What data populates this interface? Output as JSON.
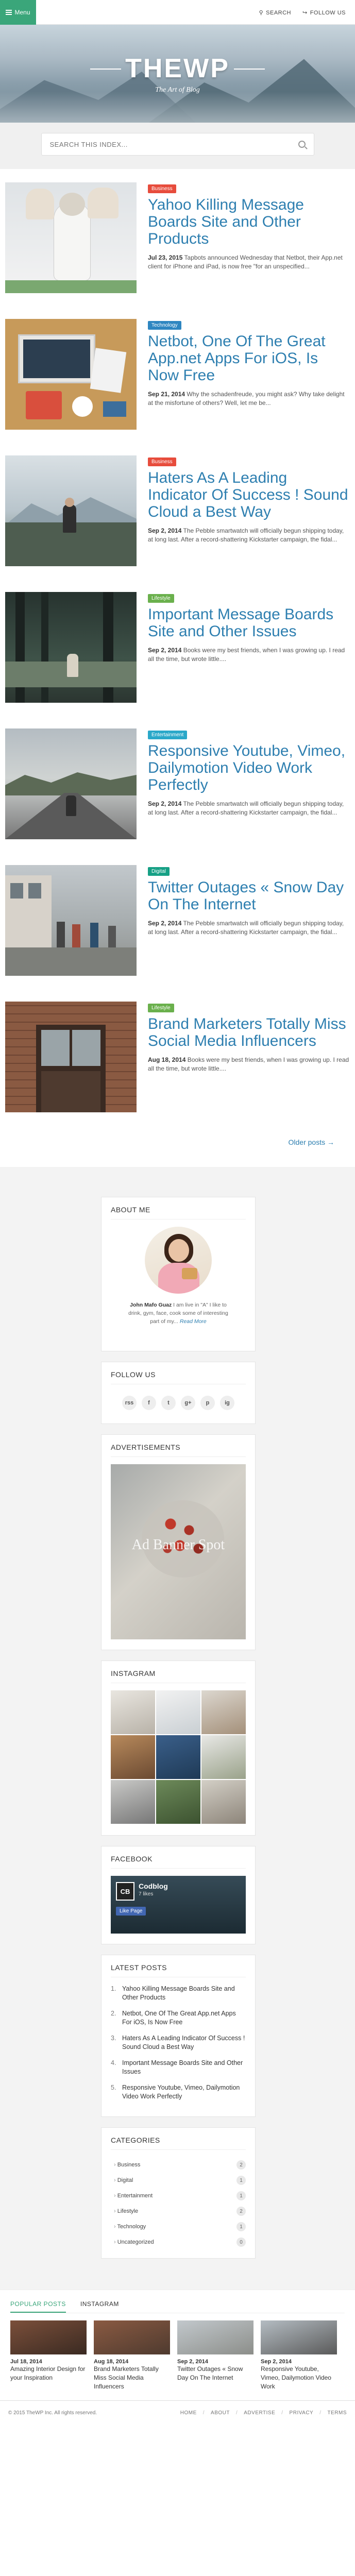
{
  "topbar": {
    "menu_label": "Menu",
    "search_label": "SEARCH",
    "follow_label": "FOLLOW US"
  },
  "hero": {
    "title": "THEWP",
    "tagline": "The Art of Blog"
  },
  "search": {
    "placeholder": "SEARCH THIS INDEX..."
  },
  "posts": [
    {
      "category": "Business",
      "category_color": "#e74c3c",
      "title": "Yahoo Killing Message Boards Site and Other Products",
      "date": "Jul 23, 2015",
      "excerpt": "Tapbots announced Wednesday that Netbot, their App.net client for iPhone and iPad, is now free \"for an unspecified..."
    },
    {
      "category": "Technology",
      "category_color": "#2e86c1",
      "title": "Netbot, One Of The Great App.net Apps For iOS, Is Now Free",
      "date": "Sep 21, 2014",
      "excerpt": "Why the schadenfreude, you might ask? Why take delight at the misfortune of others? Well, let me be..."
    },
    {
      "category": "Business",
      "category_color": "#e74c3c",
      "title": "Haters As A Leading Indicator Of Success ! Sound Cloud a Best Way",
      "date": "Sep 2, 2014",
      "excerpt": "The Pebble smartwatch will officially begun shipping today, at long last. After a record-shattering Kickstarter campaign, the fidal..."
    },
    {
      "category": "Lifestyle",
      "category_color": "#6ab04c",
      "title": "Important Message Boards Site and Other Issues",
      "date": "Sep 2, 2014",
      "excerpt": "Books were my best friends, when I was growing up. I read all the time, but wrote little...."
    },
    {
      "category": "Entertainment",
      "category_color": "#2aa8c9",
      "title": "Responsive Youtube, Vimeo, Dailymotion Video Work Perfectly",
      "date": "Sep 2, 2014",
      "excerpt": "The Pebble smartwatch will officially begun shipping today, at long last. After a record-shattering Kickstarter campaign, the fidal..."
    },
    {
      "category": "Digital",
      "category_color": "#16a085",
      "title": "Twitter Outages « Snow Day On The Internet",
      "date": "Sep 2, 2014",
      "excerpt": "The Pebble smartwatch will officially begun shipping today, at long last. After a record-shattering Kickstarter campaign, the fidal..."
    },
    {
      "category": "Lifestyle",
      "category_color": "#6ab04c",
      "title": "Brand Marketers Totally Miss Social Media Influencers",
      "date": "Aug 18, 2014",
      "excerpt": "Books were my best friends, when I was growing up. I read all the time, but wrote little...."
    }
  ],
  "older_posts": "Older posts →",
  "about": {
    "heading": "ABOUT ME",
    "name": "John Mafo Guaz",
    "text": "I am live in \"A\" I like to drink, gym, face, cook some of interesting part of my...",
    "more": "Read More"
  },
  "follow": {
    "heading": "FOLLOW US",
    "icons": [
      "rss",
      "f",
      "t",
      "g+",
      "p",
      "ig"
    ]
  },
  "ads": {
    "heading": "ADVERTISEMENTS",
    "banner_text": "Ad Banner Spot"
  },
  "instagram": {
    "heading": "INSTAGRAM"
  },
  "facebook": {
    "heading": "FACEBOOK",
    "page_name": "Codblog",
    "likes": "7 likes",
    "like_btn": "Like Page",
    "logo_text": "CB"
  },
  "latest": {
    "heading": "LATEST POSTS",
    "items": [
      "Yahoo Killing Message Boards Site and Other Products",
      "Netbot, One Of The Great App.net Apps For iOS, Is Now Free",
      "Haters As A Leading Indicator Of Success ! Sound Cloud a Best Way",
      "Important Message Boards Site and Other Issues",
      "Responsive Youtube, Vimeo, Dailymotion Video Work Perfectly"
    ]
  },
  "categories": {
    "heading": "CATEGORIES",
    "items": [
      {
        "name": "Business",
        "count": "2"
      },
      {
        "name": "Digital",
        "count": "1"
      },
      {
        "name": "Entertainment",
        "count": "1"
      },
      {
        "name": "Lifestyle",
        "count": "2"
      },
      {
        "name": "Technology",
        "count": "1"
      },
      {
        "name": "Uncategorized",
        "count": "0"
      }
    ]
  },
  "popular": {
    "tab_popular": "POPULAR POSTS",
    "tab_instagram": "INSTAGRAM",
    "items": [
      {
        "date": "Jul 18, 2014",
        "title": "Amazing Interior Design for your Inspiration"
      },
      {
        "date": "Aug 18, 2014",
        "title": "Brand Marketers Totally Miss Social Media Influencers"
      },
      {
        "date": "Sep 2, 2014",
        "title": "Twitter Outages « Snow Day On The Internet"
      },
      {
        "date": "Sep 2, 2014",
        "title": "Responsive Youtube, Vimeo, Dailymotion Video Work"
      }
    ]
  },
  "footer": {
    "copyright": "© 2015 TheWP Inc. All rights reserved.",
    "links": [
      "HOME",
      "ABOUT",
      "ADVERTISE",
      "PRIVACY",
      "TERMS"
    ]
  }
}
